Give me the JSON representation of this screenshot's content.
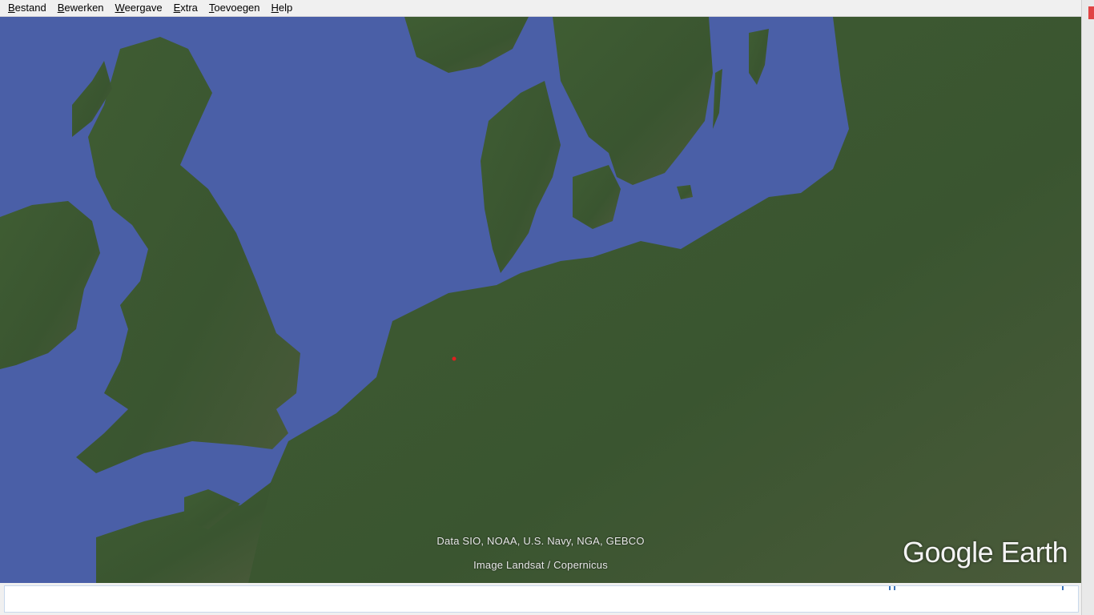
{
  "menubar": {
    "items": [
      {
        "label": "Bestand",
        "accel": "B",
        "rest": "estand"
      },
      {
        "label": "Bewerken",
        "accel": "B",
        "rest": "ewerken"
      },
      {
        "label": "Weergave",
        "accel": "W",
        "rest": "eergave"
      },
      {
        "label": "Extra",
        "accel": "E",
        "rest": "xtra"
      },
      {
        "label": "Toevoegen",
        "accel": "T",
        "rest": "oevoegen"
      },
      {
        "label": "Help",
        "accel": "H",
        "rest": "elp"
      }
    ]
  },
  "map": {
    "attribution_data": "Data SIO, NOAA, U.S. Navy, NGA, GEBCO",
    "attribution_image": "Image Landsat / Copernicus",
    "logo": "Google Earth",
    "colors": {
      "sea": "#4a5fa7",
      "land": "#3d5a30",
      "land_dark": "#2f4a26",
      "marker": "#e02020"
    }
  }
}
